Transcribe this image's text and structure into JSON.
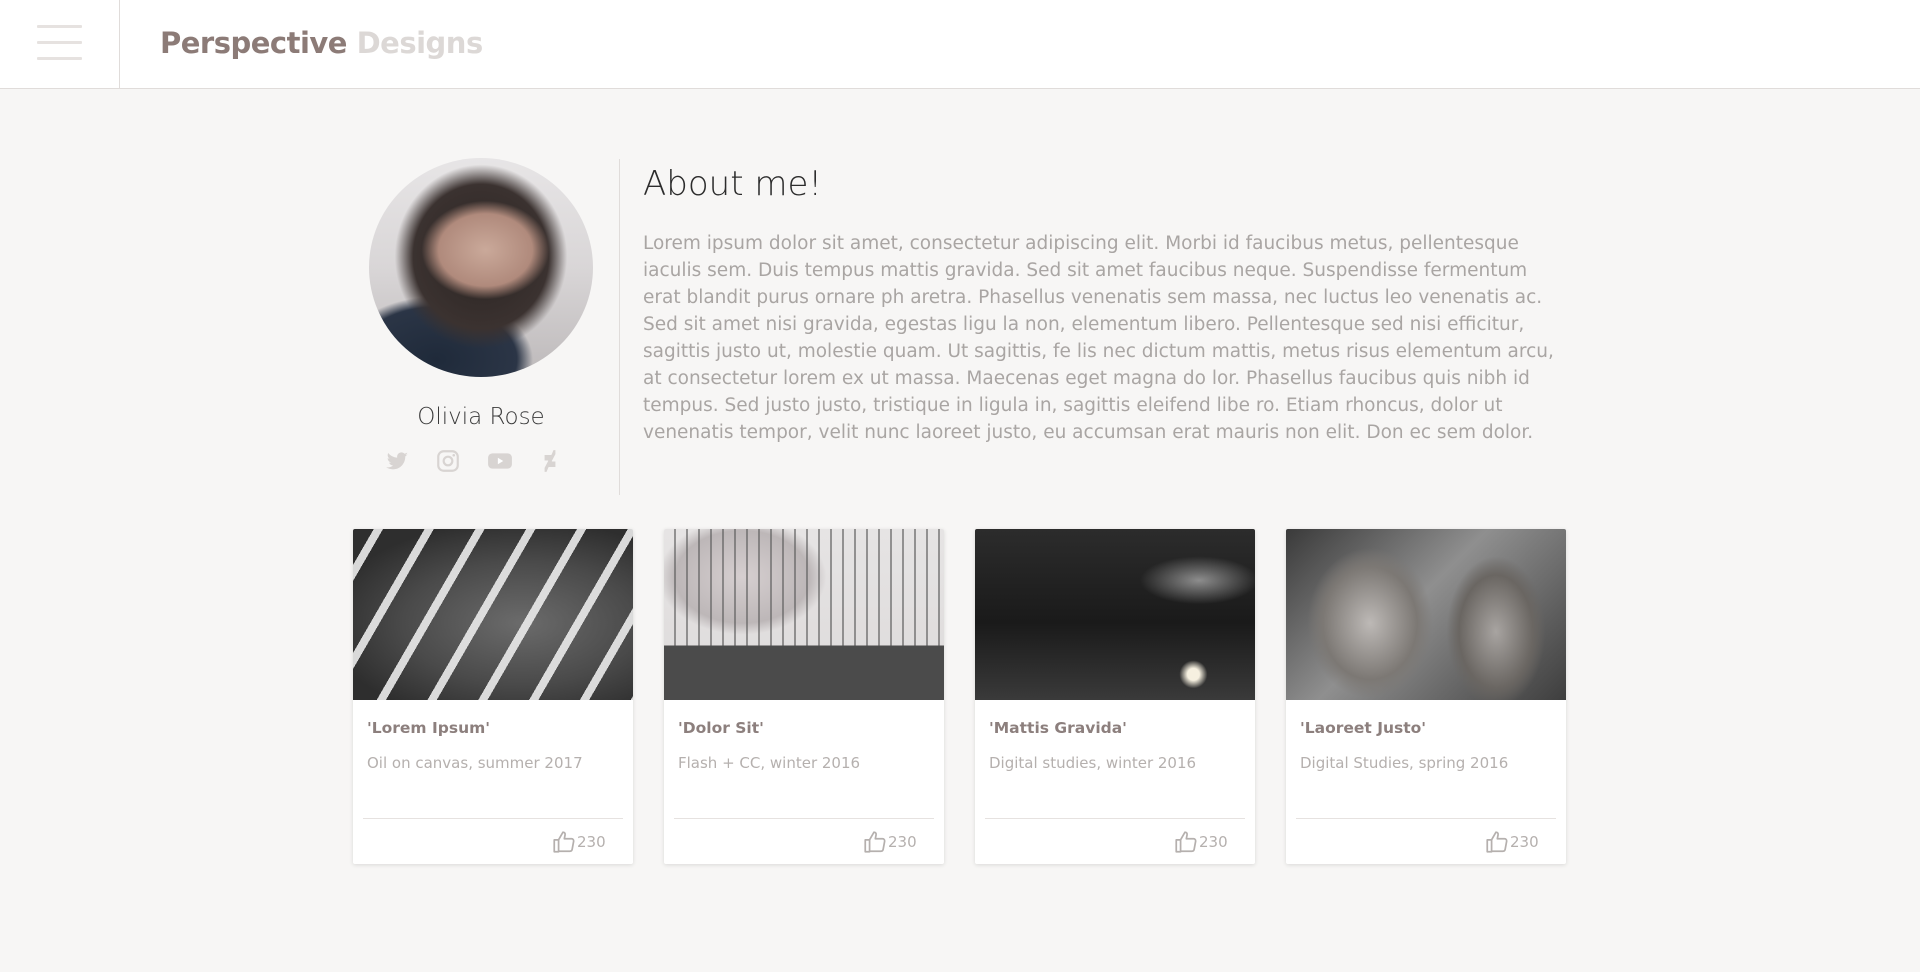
{
  "header": {
    "brand_primary": "Perspective",
    "brand_secondary": "Designs",
    "menu_icon": "hamburger-menu-icon"
  },
  "profile": {
    "name": "Olivia Rose",
    "avatar_alt": "Olivia Rose",
    "socials": [
      {
        "icon": "twitter-icon"
      },
      {
        "icon": "instagram-icon"
      },
      {
        "icon": "youtube-icon"
      },
      {
        "icon": "deviantart-icon"
      }
    ]
  },
  "about": {
    "title": "About me!",
    "text": "Lorem ipsum dolor sit amet, consectetur adipiscing elit. Morbi id faucibus metus, pellentesque iaculis sem. Duis tempus mattis gravida. Sed sit amet faucibus neque. Suspendisse fermentum erat blandit purus ornare ph aretra. Phasellus venenatis sem massa, nec luctus leo venenatis ac. Sed sit amet nisi gravida, egestas ligu la non, elementum libero. Pellentesque sed nisi efficitur, sagittis justo ut, molestie quam. Ut sagittis, fe lis nec dictum mattis, metus risus elementum arcu, at consectetur lorem ex ut massa. Maecenas eget magna do lor. Phasellus faucibus quis nibh id tempus. Sed justo justo, tristique in ligula in, sagittis eleifend libe ro. Etiam rhoncus, dolor ut venenatis tempor, velit nunc laoreet justo, eu accumsan erat mauris non elit. Don ec sem dolor."
  },
  "cards": [
    {
      "title": "'Lorem Ipsum'",
      "subtitle": "Oil on canvas, summer 2017",
      "likes": "230",
      "like_icon": "thumbs-up-icon"
    },
    {
      "title": "'Dolor Sit'",
      "subtitle": "Flash + CC, winter 2016",
      "likes": "230",
      "like_icon": "thumbs-up-icon"
    },
    {
      "title": "'Mattis Gravida'",
      "subtitle": "Digital studies, winter 2016",
      "likes": "230",
      "like_icon": "thumbs-up-icon"
    },
    {
      "title": "'Laoreet Justo'",
      "subtitle": "Digital Studies, spring 2016",
      "likes": "230",
      "like_icon": "thumbs-up-icon"
    }
  ],
  "colors": {
    "background": "#f7f6f5",
    "brand_primary": "#8c7b77",
    "brand_secondary": "#dcd8d6",
    "text_muted": "#a9a5a3",
    "card_title": "#8c7f7d"
  }
}
